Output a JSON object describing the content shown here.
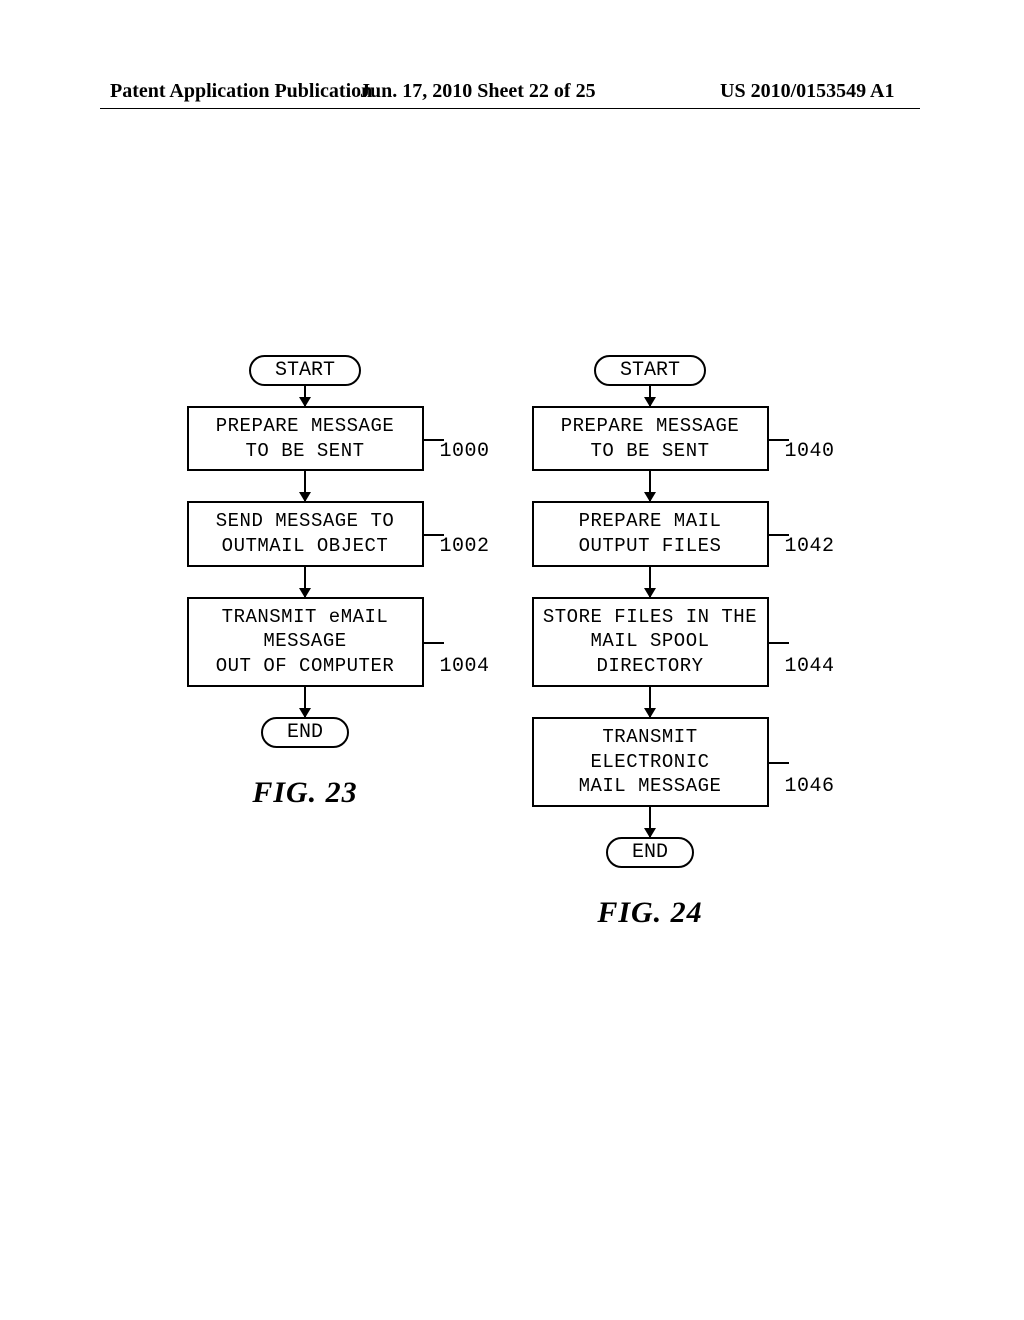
{
  "header": {
    "left": "Patent Application Publication",
    "center": "Jun. 17, 2010  Sheet 22 of 25",
    "right": "US 2010/0153549 A1"
  },
  "fig23": {
    "start": "START",
    "s1": {
      "text": "PREPARE MESSAGE\nTO BE SENT",
      "ref": "1000"
    },
    "s2": {
      "text": "SEND MESSAGE TO\nOUTMAIL OBJECT",
      "ref": "1002"
    },
    "s3": {
      "text": "TRANSMIT eMAIL MESSAGE\nOUT OF COMPUTER",
      "ref": "1004"
    },
    "end": "END",
    "caption": "FIG. 23"
  },
  "fig24": {
    "start": "START",
    "s1": {
      "text": "PREPARE MESSAGE\nTO BE SENT",
      "ref": "1040"
    },
    "s2": {
      "text": "PREPARE MAIL\nOUTPUT FILES",
      "ref": "1042"
    },
    "s3": {
      "text": "STORE FILES IN THE\nMAIL SPOOL DIRECTORY",
      "ref": "1044"
    },
    "s4": {
      "text": "TRANSMIT ELECTRONIC\nMAIL MESSAGE",
      "ref": "1046"
    },
    "end": "END",
    "caption": "FIG. 24"
  }
}
